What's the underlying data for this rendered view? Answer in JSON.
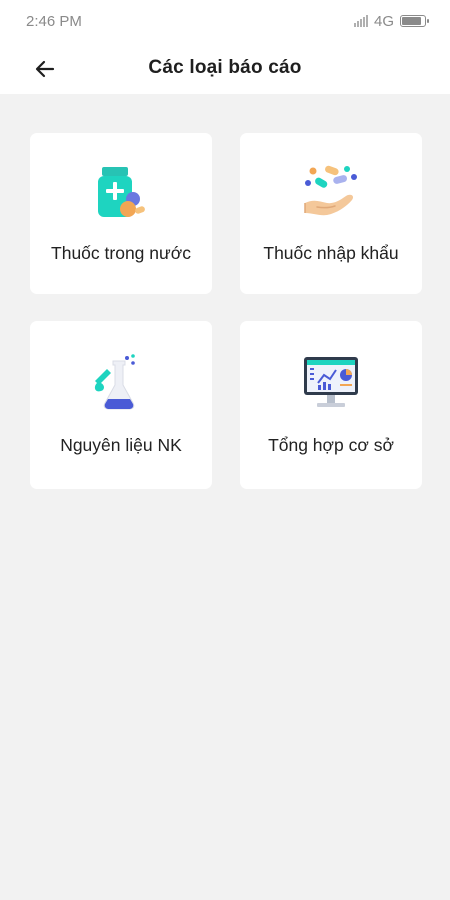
{
  "status_bar": {
    "time": "2:46 PM",
    "network": "4G"
  },
  "app_bar": {
    "title": "Các loại báo cáo",
    "back_icon": "arrow-left-icon"
  },
  "report_types": [
    {
      "label": "Thuốc trong nước",
      "icon": "medicine-bottle-icon"
    },
    {
      "label": "Thuốc nhập khẩu",
      "icon": "pills-hand-icon"
    },
    {
      "label": "Nguyên liệu NK",
      "icon": "lab-flask-icon"
    },
    {
      "label": "Tổng hợp cơ sở",
      "icon": "dashboard-monitor-icon"
    }
  ],
  "colors": {
    "background": "#f2f2f2",
    "card": "#ffffff",
    "accent_teal": "#1ed4c0",
    "accent_orange": "#f2a654",
    "accent_blue": "#4a5bd6"
  }
}
